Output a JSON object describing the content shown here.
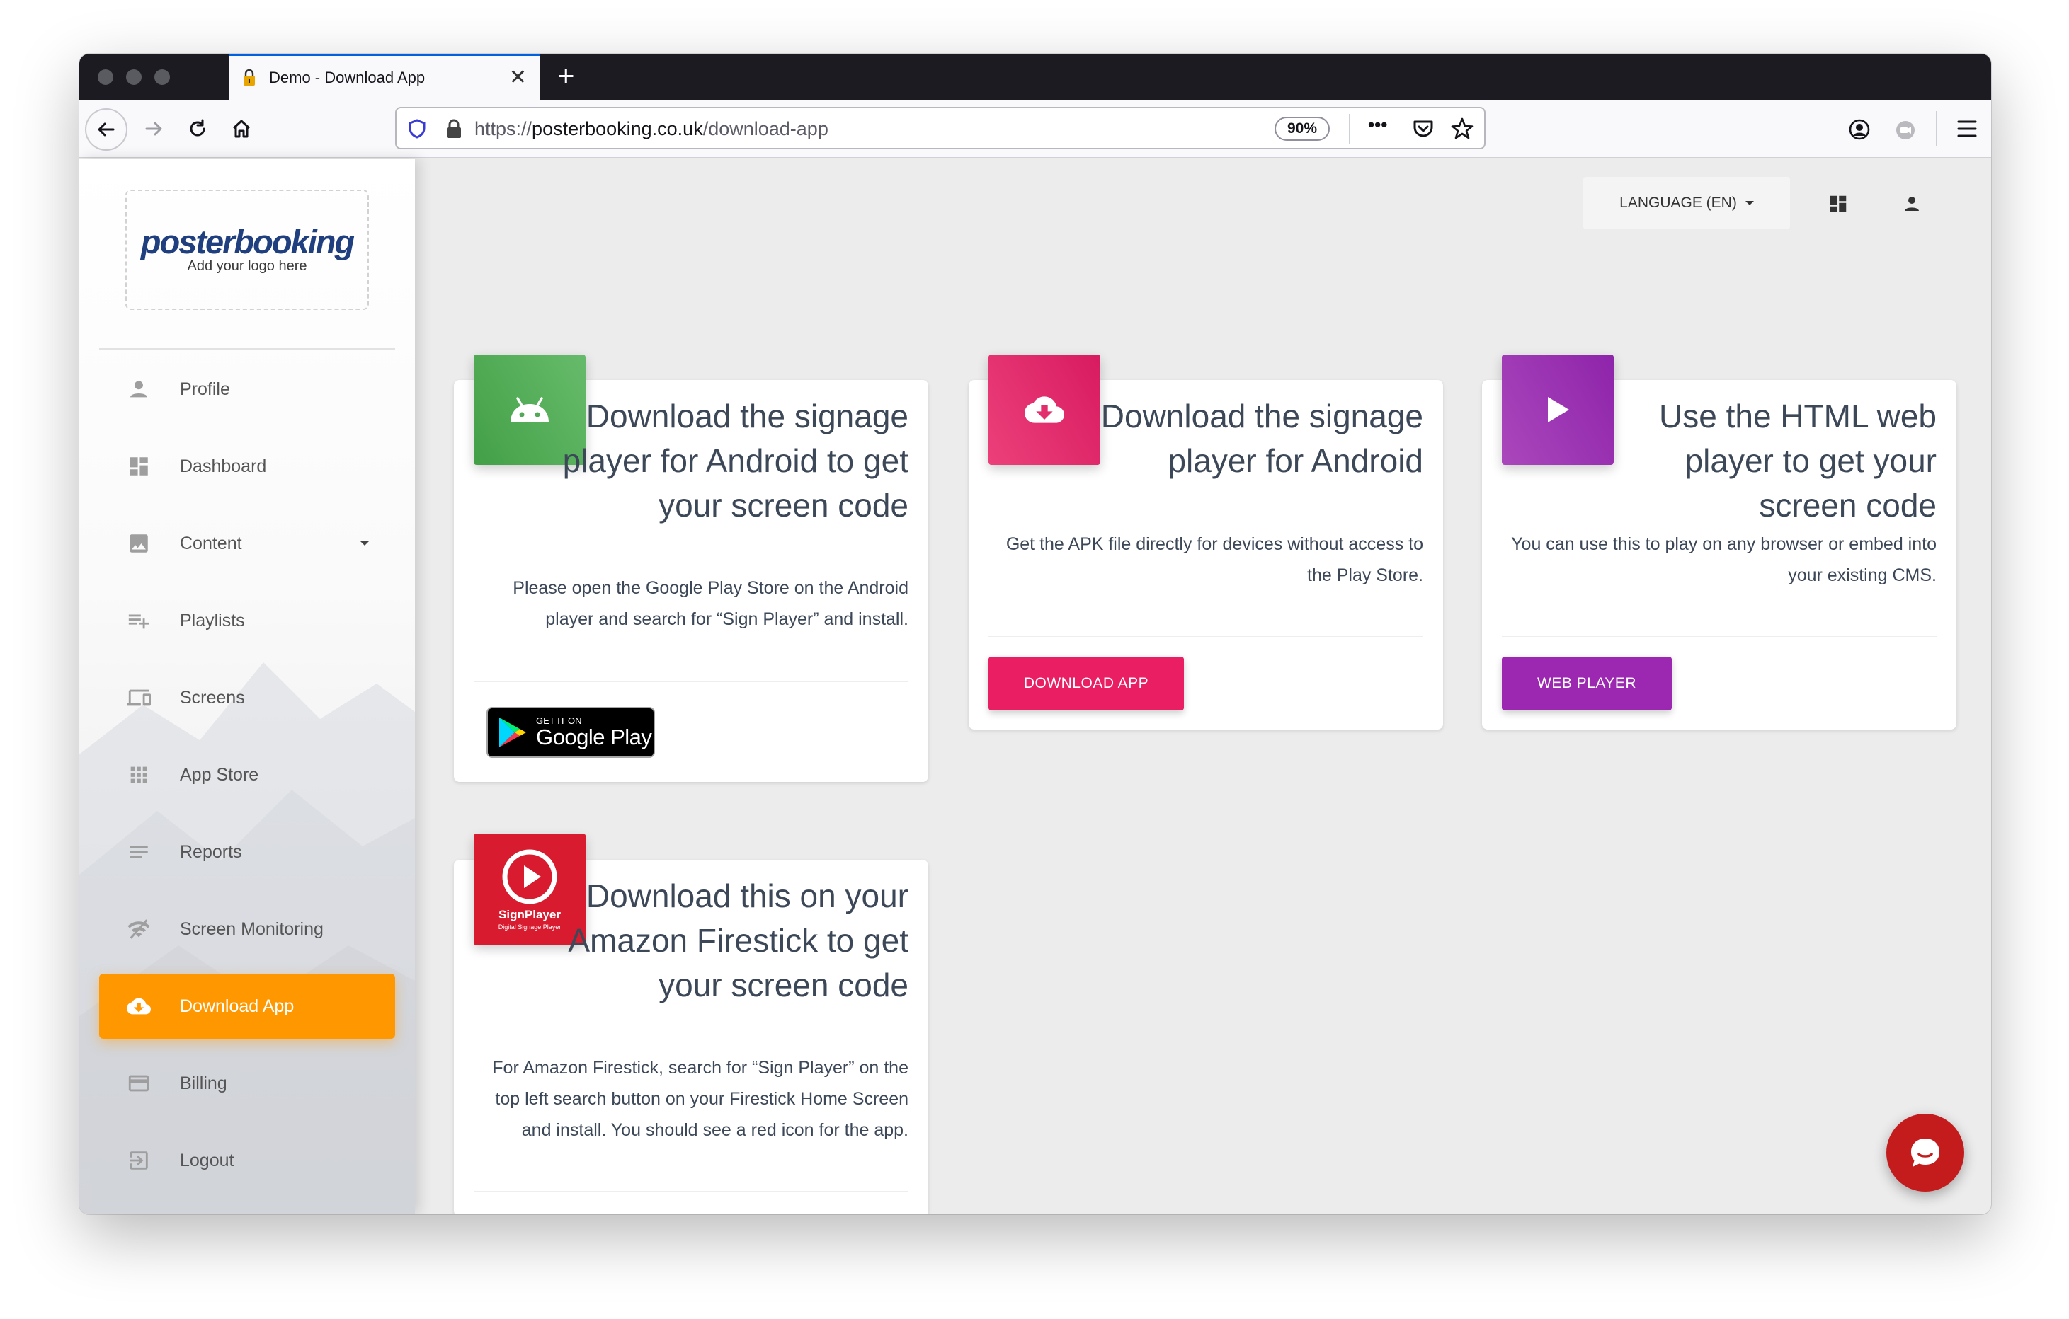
{
  "browser": {
    "tab_title": "Demo - Download App",
    "url_prefix": "https://",
    "url_domain": "posterbooking.co.uk",
    "url_path": "/download-app",
    "zoom": "90%",
    "overflow_label": "•••"
  },
  "sidebar": {
    "logo_text": "posterbooking",
    "logo_sub": "Add your logo here",
    "items": [
      {
        "label": "Profile",
        "icon": "person-icon"
      },
      {
        "label": "Dashboard",
        "icon": "dashboard-icon"
      },
      {
        "label": "Content",
        "icon": "image-icon"
      },
      {
        "label": "Playlists",
        "icon": "playlist-add-icon"
      },
      {
        "label": "Screens",
        "icon": "devices-icon"
      },
      {
        "label": "App Store",
        "icon": "apps-grid-icon"
      },
      {
        "label": "Reports",
        "icon": "notes-icon"
      },
      {
        "label": "Screen Monitoring",
        "icon": "wifi-off-icon"
      },
      {
        "label": "Download App",
        "icon": "cloud-download-icon"
      },
      {
        "label": "Billing",
        "icon": "credit-card-icon"
      },
      {
        "label": "Logout",
        "icon": "logout-icon"
      }
    ],
    "active_color": "#ff9800"
  },
  "header": {
    "language_label": "LANGUAGE (EN)"
  },
  "cards": {
    "android_play": {
      "title": "Download the signage player for Android to get your screen code",
      "desc": "Please open the Google Play Store on the Android player and search for “Sign Player” and install.",
      "badge_small": "GET IT ON",
      "badge_big": "Google Play",
      "color": "#4caf50"
    },
    "android_apk": {
      "title": "Download the signage player for Android",
      "desc": "Get the APK file directly for devices without access to the Play Store.",
      "button": "DOWNLOAD APP",
      "color": "#e91e63"
    },
    "web_player": {
      "title": "Use the HTML web player to get your screen code",
      "desc": "You can use this to play on any browser or embed into your existing CMS.",
      "button": "WEB PLAYER",
      "color": "#9c27b0"
    },
    "firestick": {
      "title": "Download this on your Amazon Firestick to get your screen code",
      "desc": "For Amazon Firestick, search for “Sign Player” on the top left search button on your Firestick Home Screen and install. You should see a red icon for the app.",
      "icon_name": "SignPlayer",
      "icon_sub": "Digital Signage Player",
      "color": "#d81b2e"
    }
  },
  "chat": {
    "color": "#c41c1c"
  }
}
